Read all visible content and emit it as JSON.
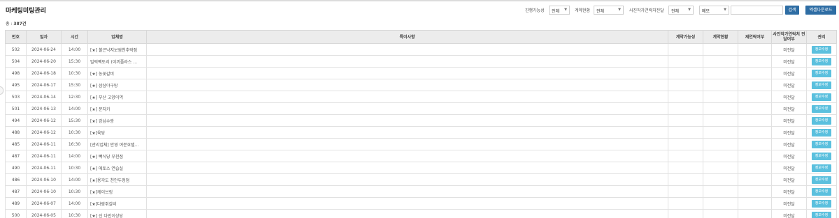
{
  "page": {
    "title": "마케팅미팅관리",
    "total_label": "총 : ",
    "total_count": "387건"
  },
  "filters": {
    "status_label": "진행가능성",
    "status_value": "전체",
    "contract_label": "계약현황",
    "contract_value": "전체",
    "photo_label": "사진작가연락처전달",
    "photo_value": "전체",
    "field_value": "메모",
    "search_value": "",
    "search_button": "검색",
    "excel_button": "엑셀다운로드"
  },
  "table": {
    "headers": [
      "번호",
      "일자",
      "시간",
      "업체명",
      "특이사항",
      "계약가능성",
      "계약현황",
      "재연락여부",
      "사진작가연락처 전달여부",
      "관리"
    ],
    "rows": [
      {
        "no": "502",
        "date": "2024-06-24",
        "time": "14:00",
        "company": "[★] 불곤낙지보쌈천추락점",
        "note": "",
        "possibility": "",
        "contract": "",
        "recontact": "",
        "delivered": "미전달",
        "action": "정보수정"
      },
      {
        "no": "504",
        "date": "2024-06-20",
        "time": "15:30",
        "company": "밀럭팩토리 (이끼플라스 ...",
        "note": "",
        "possibility": "",
        "contract": "",
        "recontact": "",
        "delivered": "미전달",
        "action": "정보수정"
      },
      {
        "no": "498",
        "date": "2024-06-18",
        "time": "10:30",
        "company": "[★] 농꽃갈비",
        "note": "",
        "possibility": "",
        "contract": "",
        "recontact": "",
        "delivered": "미전달",
        "action": "정보수정"
      },
      {
        "no": "495",
        "date": "2024-06-17",
        "time": "15:30",
        "company": "[★] 삼삼야구탕",
        "note": "",
        "possibility": "",
        "contract": "",
        "recontact": "",
        "delivered": "미전달",
        "action": "정보수정"
      },
      {
        "no": "503",
        "date": "2024-06-14",
        "time": "12:30",
        "company": "[★] 부산 고양이역",
        "note": "",
        "possibility": "",
        "contract": "",
        "recontact": "",
        "delivered": "미전달",
        "action": "정보수정"
      },
      {
        "no": "501",
        "date": "2024-06-13",
        "time": "14:00",
        "company": "[★] 분자카",
        "note": "",
        "possibility": "",
        "contract": "",
        "recontact": "",
        "delivered": "미전달",
        "action": "정보수정"
      },
      {
        "no": "494",
        "date": "2024-06-12",
        "time": "15:30",
        "company": "[★] 강남수랑",
        "note": "",
        "possibility": "",
        "contract": "",
        "recontact": "",
        "delivered": "미전달",
        "action": "정보수정"
      },
      {
        "no": "488",
        "date": "2024-06-12",
        "time": "10:30",
        "company": "[★]육당",
        "note": "",
        "possibility": "",
        "contract": "",
        "recontact": "",
        "delivered": "미전달",
        "action": "정보수정"
      },
      {
        "no": "485",
        "date": "2024-06-11",
        "time": "16:30",
        "company": "[관리업체] 안영 여분호텔...",
        "note": "",
        "possibility": "",
        "contract": "",
        "recontact": "",
        "delivered": "미전달",
        "action": "정보수정"
      },
      {
        "no": "487",
        "date": "2024-06-11",
        "time": "14:00",
        "company": "[★] 빽식당 부천점",
        "note": "",
        "possibility": "",
        "contract": "",
        "recontact": "",
        "delivered": "미전달",
        "action": "정보수정"
      },
      {
        "no": "490",
        "date": "2024-06-11",
        "time": "10:30",
        "company": "[★] 에토스 연습실",
        "note": "",
        "possibility": "",
        "contract": "",
        "recontact": "",
        "delivered": "미전달",
        "action": "정보수정"
      },
      {
        "no": "486",
        "date": "2024-06-10",
        "time": "14:00",
        "company": "[★]용각도 천안두정점",
        "note": "",
        "possibility": "",
        "contract": "",
        "recontact": "",
        "delivered": "미전달",
        "action": "정보수정"
      },
      {
        "no": "487",
        "date": "2024-06-10",
        "time": "10:30",
        "company": "[★]케이브링",
        "note": "",
        "possibility": "",
        "contract": "",
        "recontact": "",
        "delivered": "미전달",
        "action": "정보수정"
      },
      {
        "no": "489",
        "date": "2024-06-07",
        "time": "14:00",
        "company": "[★]다람쥐갈비",
        "note": "",
        "possibility": "",
        "contract": "",
        "recontact": "",
        "delivered": "미전달",
        "action": "정보수정"
      },
      {
        "no": "500",
        "date": "2024-06-05",
        "time": "10:30",
        "company": "[★] 신 다인이상당",
        "note": "",
        "possibility": "",
        "contract": "",
        "recontact": "",
        "delivered": "미전달",
        "action": "정보수정"
      }
    ]
  }
}
